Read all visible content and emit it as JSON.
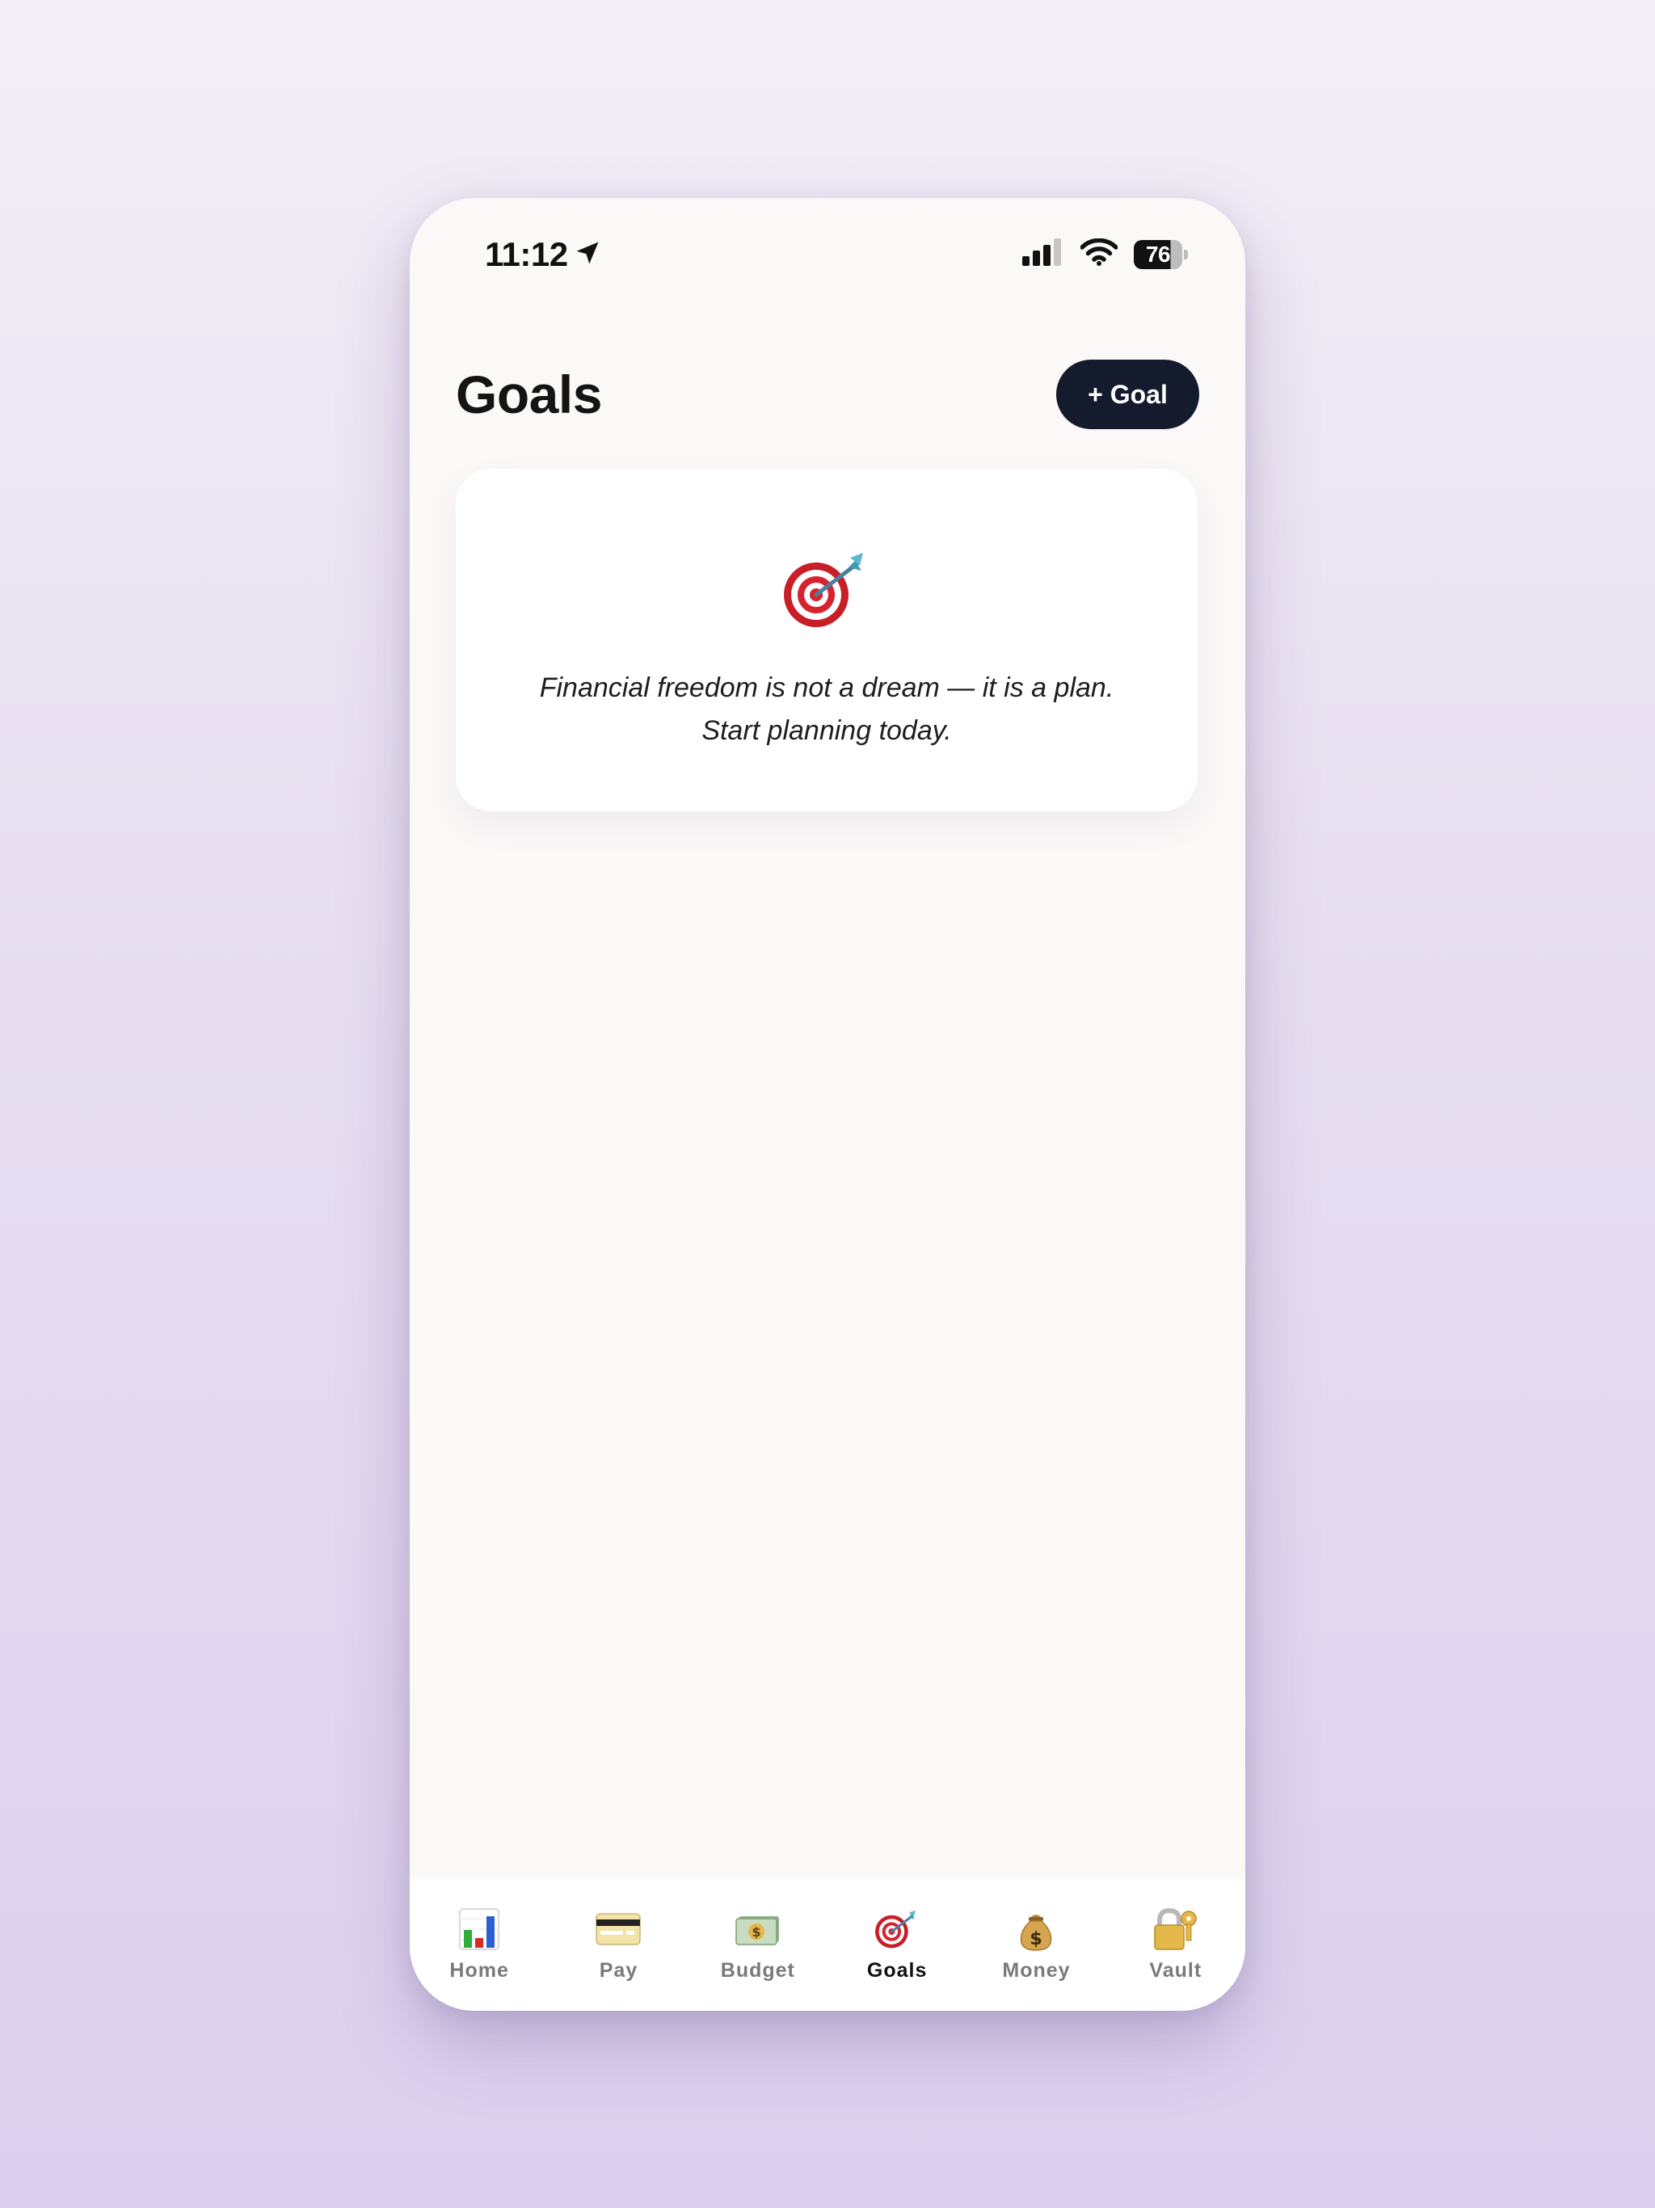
{
  "status_bar": {
    "time": "11:12",
    "battery": "76",
    "battery_level": 0.76
  },
  "header": {
    "title": "Goals",
    "add_button_label": "+ Goal"
  },
  "empty_state": {
    "icon": "target-icon",
    "line1": "Financial freedom is not a dream — it is a plan.",
    "line2": "Start planning today."
  },
  "tabbar": {
    "active": "Goals",
    "items": [
      {
        "label": "Home",
        "icon": "bar-chart-icon"
      },
      {
        "label": "Pay",
        "icon": "credit-card-icon"
      },
      {
        "label": "Budget",
        "icon": "banknote-icon"
      },
      {
        "label": "Goals",
        "icon": "target-icon"
      },
      {
        "label": "Money",
        "icon": "money-bag-icon"
      },
      {
        "label": "Vault",
        "icon": "lock-key-icon"
      }
    ]
  },
  "colors": {
    "accent": "#141b2d",
    "background": "#fbf8f8"
  }
}
